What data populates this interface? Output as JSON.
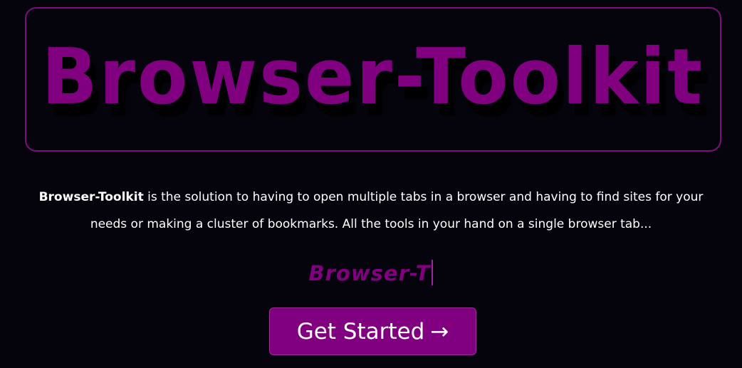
{
  "hero": {
    "title": "Browser-Toolkit"
  },
  "description": {
    "brand": "Browser-Toolkit",
    "line1_rest": " is the solution to having to open multiple tabs in a browser and having to find sites for your",
    "line2": "needs or making a cluster of bookmarks. All the tools in your hand on a single browser tab..."
  },
  "typing": {
    "text": "Browser-T"
  },
  "cta": {
    "label": "Get Started",
    "arrow": "→"
  },
  "colors": {
    "background": "#05040d",
    "accent": "#800080",
    "text": "#ffffff"
  }
}
